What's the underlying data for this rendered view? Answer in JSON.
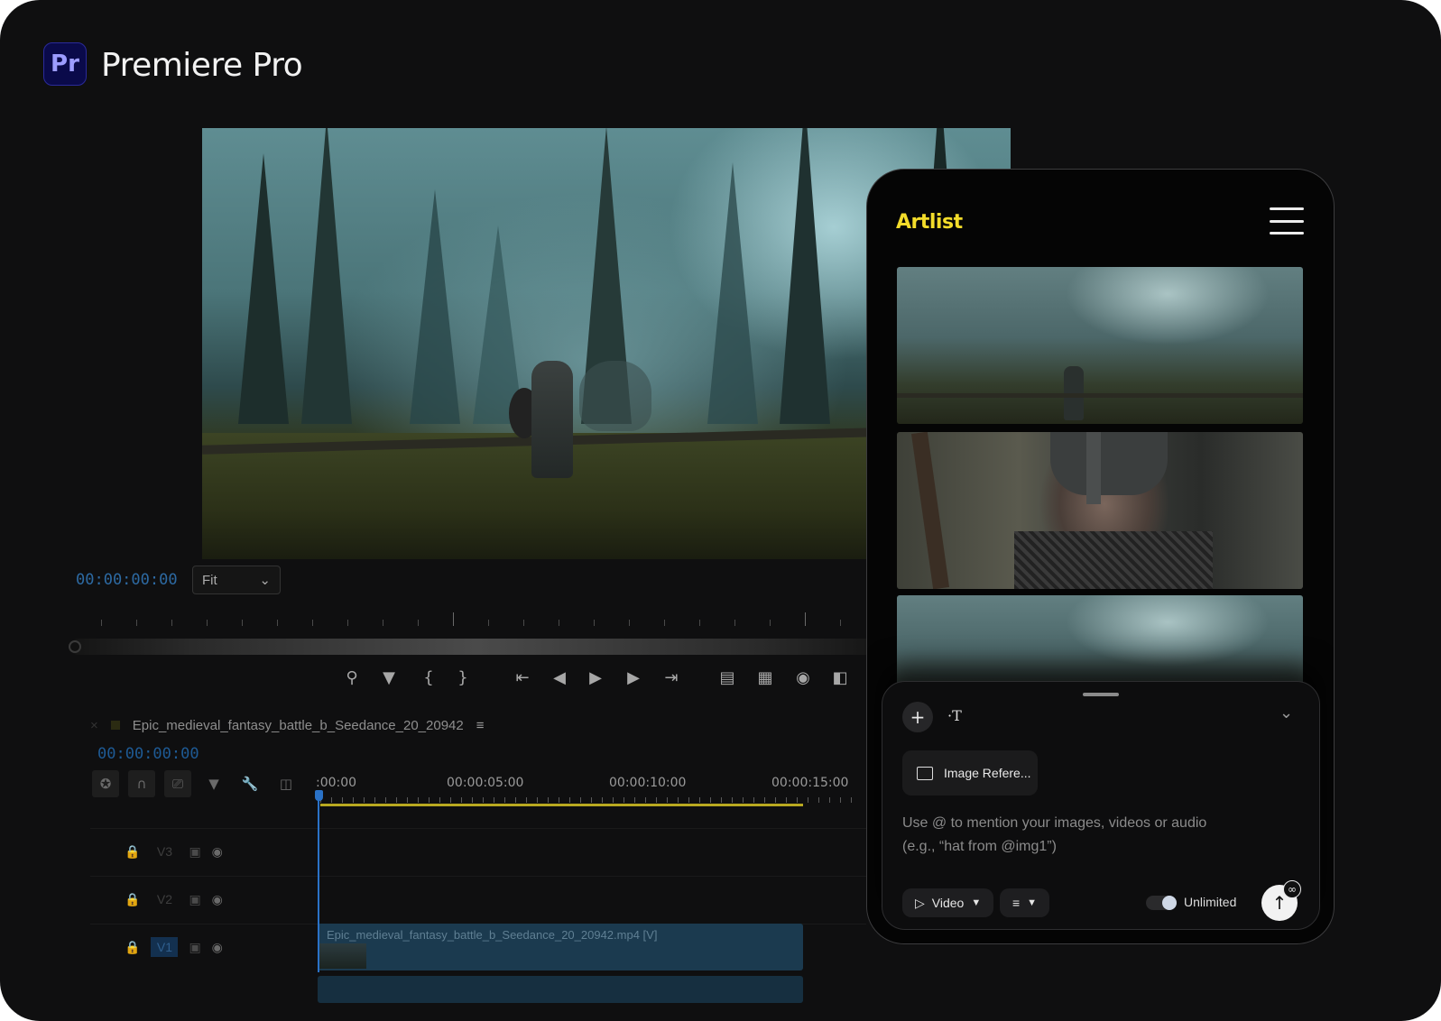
{
  "app": {
    "logo_text": "Pr",
    "name": "Premiere Pro",
    "brand_color": "#9c9cff"
  },
  "program_monitor": {
    "timecode": "00:00:00:00",
    "zoom_select": {
      "value": "Fit",
      "icon": "chevron-down-icon"
    },
    "transport_icons": [
      "export-frame-icon",
      "marker-icon",
      "mark-in-icon",
      "mark-out-icon",
      "go-to-in-icon",
      "step-back-icon",
      "play-icon",
      "step-forward-icon",
      "go-to-out-icon",
      "lift-icon",
      "extract-icon",
      "camera-icon",
      "compare-icon"
    ]
  },
  "timeline": {
    "sequence_name": "Epic_medieval_fantasy_battle_b_Seedance_20_20942",
    "menu_icon": "hamburger-menu-icon",
    "timecode": "00:00:00:00",
    "ruler_labels": [
      ":00:00",
      "00:00:05:00",
      "00:00:10:00",
      "00:00:15:00"
    ],
    "tracks": [
      {
        "name": "V3"
      },
      {
        "name": "V2"
      },
      {
        "name": "V1"
      }
    ],
    "clip_name": "Epic_medieval_fantasy_battle_b_Seedance_20_20942.mp4 [V]"
  },
  "artlist": {
    "logo": "Artlist",
    "brand_color": "#f3dc2a",
    "thumbnails": [
      "forest-warrior-wide",
      "warrior-closeup",
      "forest-wide-2"
    ],
    "image_reference_label": "Image Refere...",
    "prompt_placeholder_line1": "Use @ to mention your images, videos or audio",
    "prompt_placeholder_line2": "(e.g., “hat from @img1”)",
    "mode_label": "Video",
    "unlimited_label": "Unlimited",
    "unlimited_enabled": true
  }
}
